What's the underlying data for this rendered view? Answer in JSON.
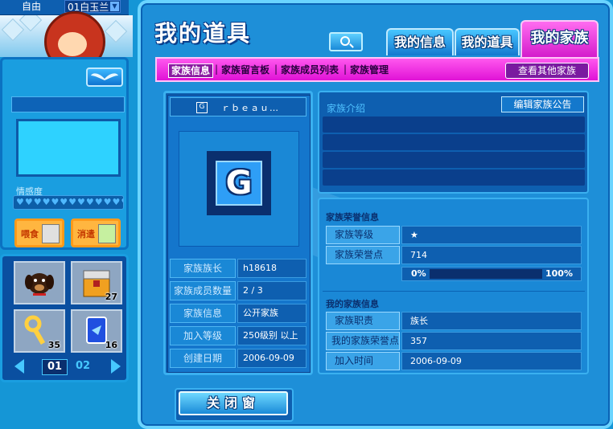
{
  "top_bar": {
    "mode": "自由",
    "player": "01白玉兰"
  },
  "pet_panel": {
    "affection_label": "情感度",
    "hearts": "♥♥♥♥♥♥♥♥♥♥♥♥♥♥♥♥",
    "feed_label": "喂食",
    "fun_label": "消遣"
  },
  "inventory": {
    "items": [
      {
        "icon": "dog-icon",
        "count": ""
      },
      {
        "icon": "chest-icon",
        "count": "27"
      },
      {
        "icon": "key-icon",
        "count": "35"
      },
      {
        "icon": "card-icon",
        "count": "16"
      }
    ],
    "pages": [
      "01",
      "02"
    ]
  },
  "window": {
    "title": "我的道具",
    "tabs": [
      "我的信息",
      "我的道具",
      "我的家族"
    ],
    "active_tab": "我的家族",
    "subnav": [
      "家族信息",
      "家族留言板",
      "家族成员列表",
      "家族管理"
    ],
    "other_families": "查看其他家族",
    "close": "关闭窗"
  },
  "family": {
    "name": "ｒｂｅａｕ…",
    "emblem_letter": "G",
    "info": [
      {
        "label": "家族族长",
        "value": "h18618"
      },
      {
        "label": "家族成员数量",
        "value": "2 / 3"
      },
      {
        "label": "家族信息",
        "value": "公开家族"
      },
      {
        "label": "加入等级",
        "value": "250级别 以上"
      },
      {
        "label": "创建日期",
        "value": "2006-09-09"
      }
    ],
    "intro_title": "家族介绍",
    "edit_announcement": "编辑家族公告",
    "honor_title": "家族荣誉信息",
    "honor": [
      {
        "label": "家族等级",
        "value": "★"
      },
      {
        "label": "家族荣誉点",
        "value": "714"
      }
    ],
    "progress": {
      "min": "0%",
      "max": "100%",
      "value": 0
    },
    "my_title": "我的家族信息",
    "my_info": [
      {
        "label": "家族职责",
        "value": "族长"
      },
      {
        "label": "我的家族荣誉点",
        "value": "357"
      },
      {
        "label": "加入时间",
        "value": "2006-09-09"
      }
    ]
  }
}
